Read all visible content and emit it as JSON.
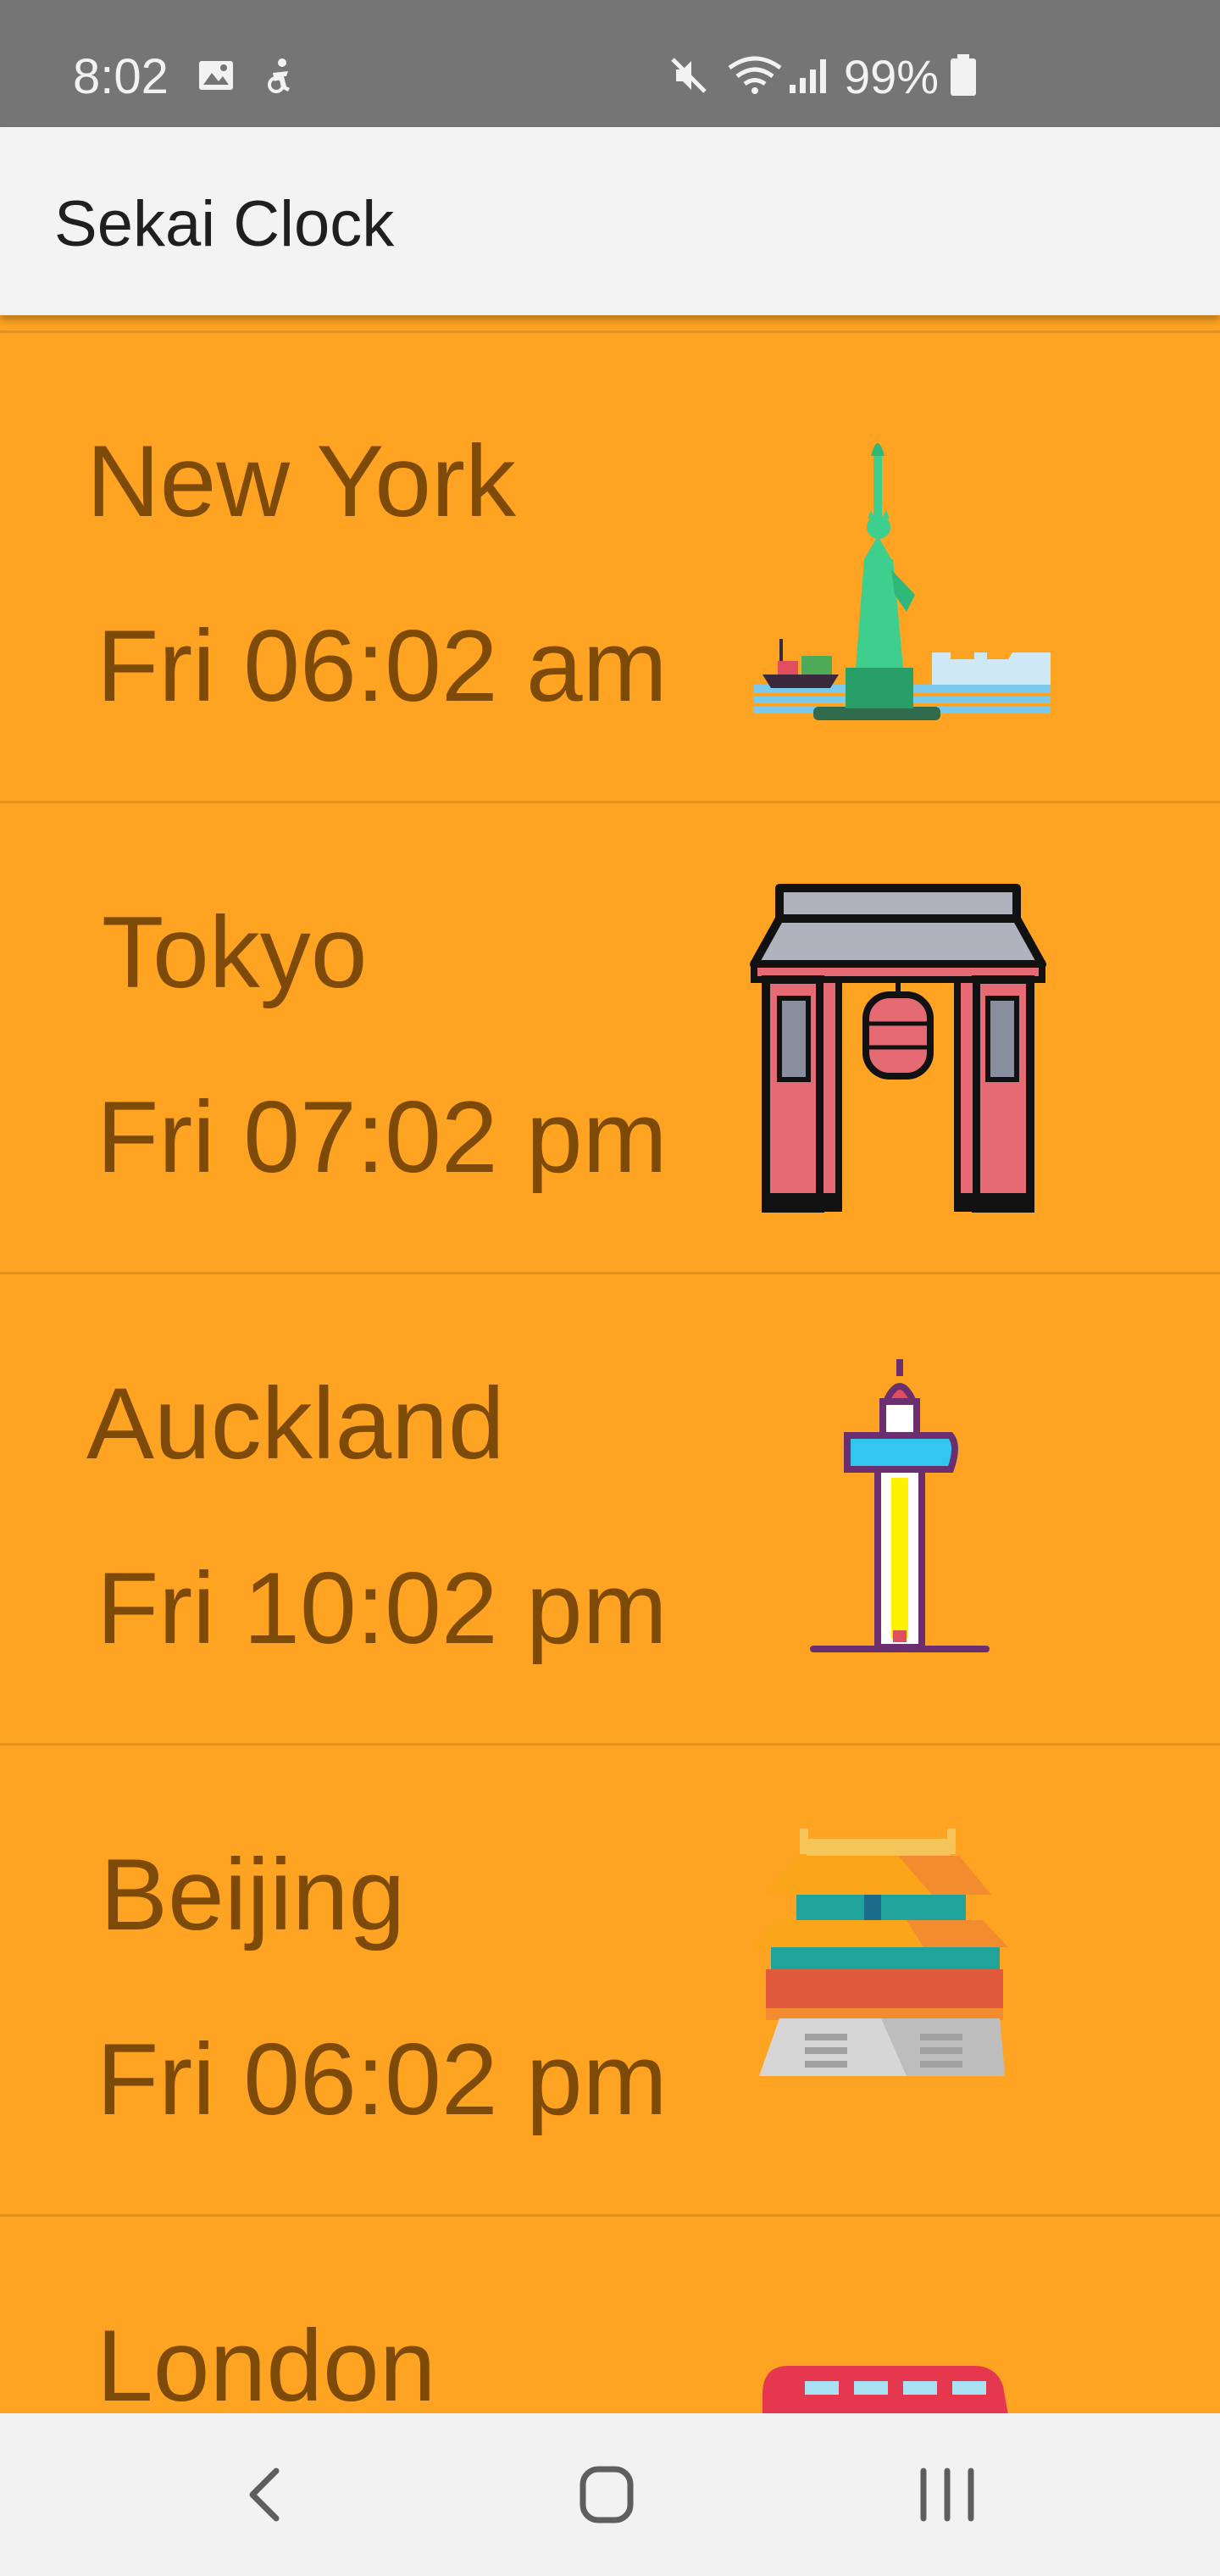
{
  "status_bar": {
    "time": "8:02",
    "battery": "99%",
    "icons": [
      "image-icon",
      "accessibility-icon",
      "mute-icon",
      "wifi-icon",
      "signal-icon",
      "battery-icon"
    ]
  },
  "app_bar": {
    "title": "Sekai Clock"
  },
  "cities": [
    {
      "name": "New York",
      "time": "Fri 06:02 am",
      "landmark": "statue-of-liberty-icon"
    },
    {
      "name": "Tokyo",
      "time": "Fri 07:02 pm",
      "landmark": "kaminarimon-gate-icon"
    },
    {
      "name": "Auckland",
      "time": "Fri 10:02 pm",
      "landmark": "sky-tower-icon"
    },
    {
      "name": "Beijing",
      "time": "Fri 06:02 pm",
      "landmark": "forbidden-city-icon"
    },
    {
      "name": "London",
      "time": "",
      "landmark": "double-decker-bus-icon"
    }
  ],
  "nav_bar": {
    "buttons": [
      "back-icon",
      "home-icon",
      "recents-icon"
    ]
  },
  "colors": {
    "background": "#FFA322",
    "text": "#7D4A08",
    "divider": "#E2921C",
    "status_bar": "#757575",
    "app_bar": "#F3F3F3"
  }
}
